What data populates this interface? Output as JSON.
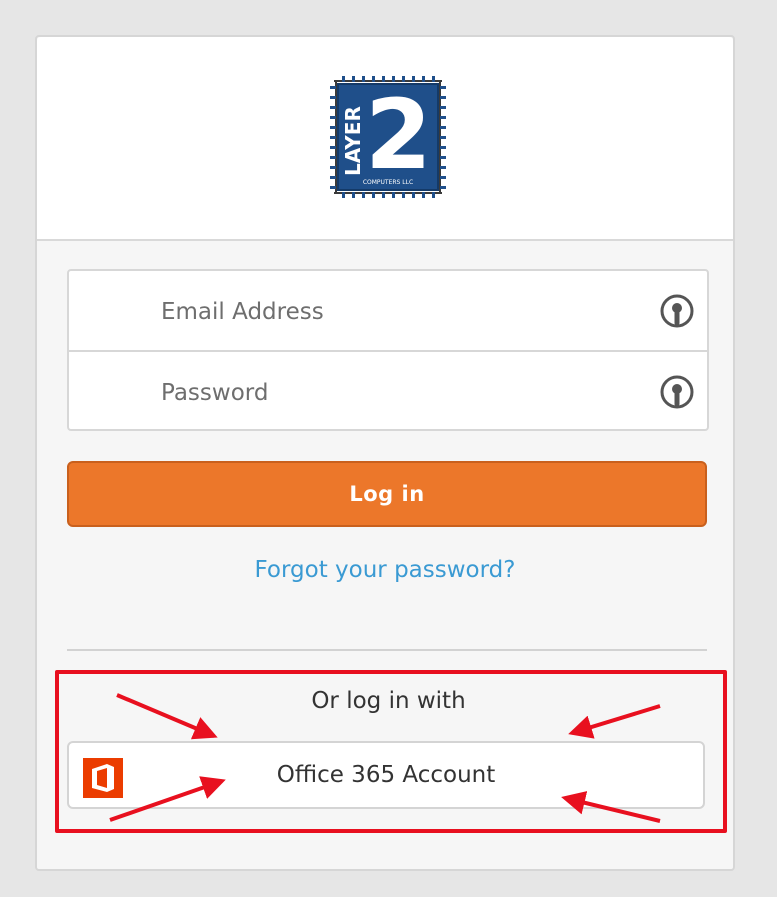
{
  "logo": {
    "brand_text": "2",
    "vertical_text": "LAYER",
    "sub_text": "COMPUTERS LLC",
    "color": "#1f4f8a"
  },
  "login_form": {
    "email_placeholder": "Email Address",
    "password_placeholder": "Password",
    "field_icon": "key-icon",
    "login_label": "Log in",
    "forgot_label": "Forgot your password?"
  },
  "alt_login": {
    "or_label": "Or log in with",
    "o365_label": "Office 365 Account",
    "o365_icon": "office-icon"
  },
  "colors": {
    "login_button": "#ec772a",
    "link": "#3a9ad3",
    "annotation_red": "#e8101f",
    "office_orange": "#eb3c00"
  }
}
